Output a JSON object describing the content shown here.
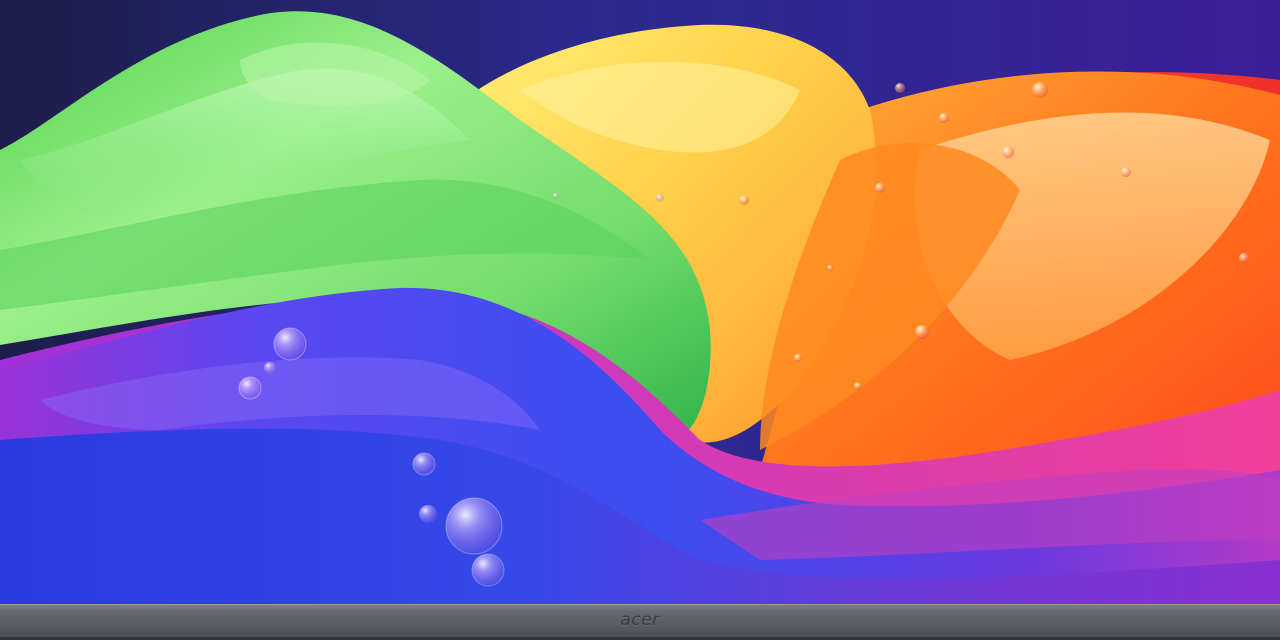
{
  "monitor": {
    "brand_logo": "acer"
  },
  "wallpaper": {
    "description_colors": {
      "sky": "#2a1f7a",
      "green": "#7fe07a",
      "yellow": "#ffd55a",
      "orange": "#ff7a1e",
      "red": "#f0322a",
      "blue": "#3a46e0",
      "magenta": "#c236c8",
      "violet": "#7a34d8"
    }
  }
}
